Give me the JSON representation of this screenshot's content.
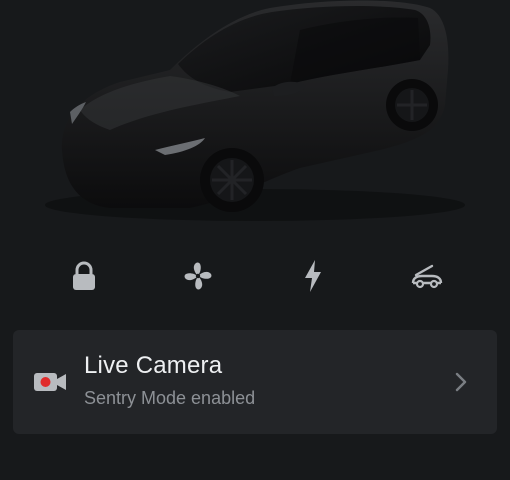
{
  "vehicle": {
    "image": "black-suv-front-three-quarter"
  },
  "quick_controls": [
    {
      "icon": "lock-icon"
    },
    {
      "icon": "fan-icon"
    },
    {
      "icon": "charge-bolt-icon"
    },
    {
      "icon": "frunk-icon"
    }
  ],
  "live_camera": {
    "title": "Live Camera",
    "subtitle": "Sentry Mode enabled",
    "icon": "camera-icon",
    "record_dot_color": "#e02b2b"
  },
  "colors": {
    "background": "#17191b",
    "card": "#232528",
    "icon": "#b8bbbf",
    "title": "#eef0f2",
    "subtitle": "#8d9196"
  }
}
